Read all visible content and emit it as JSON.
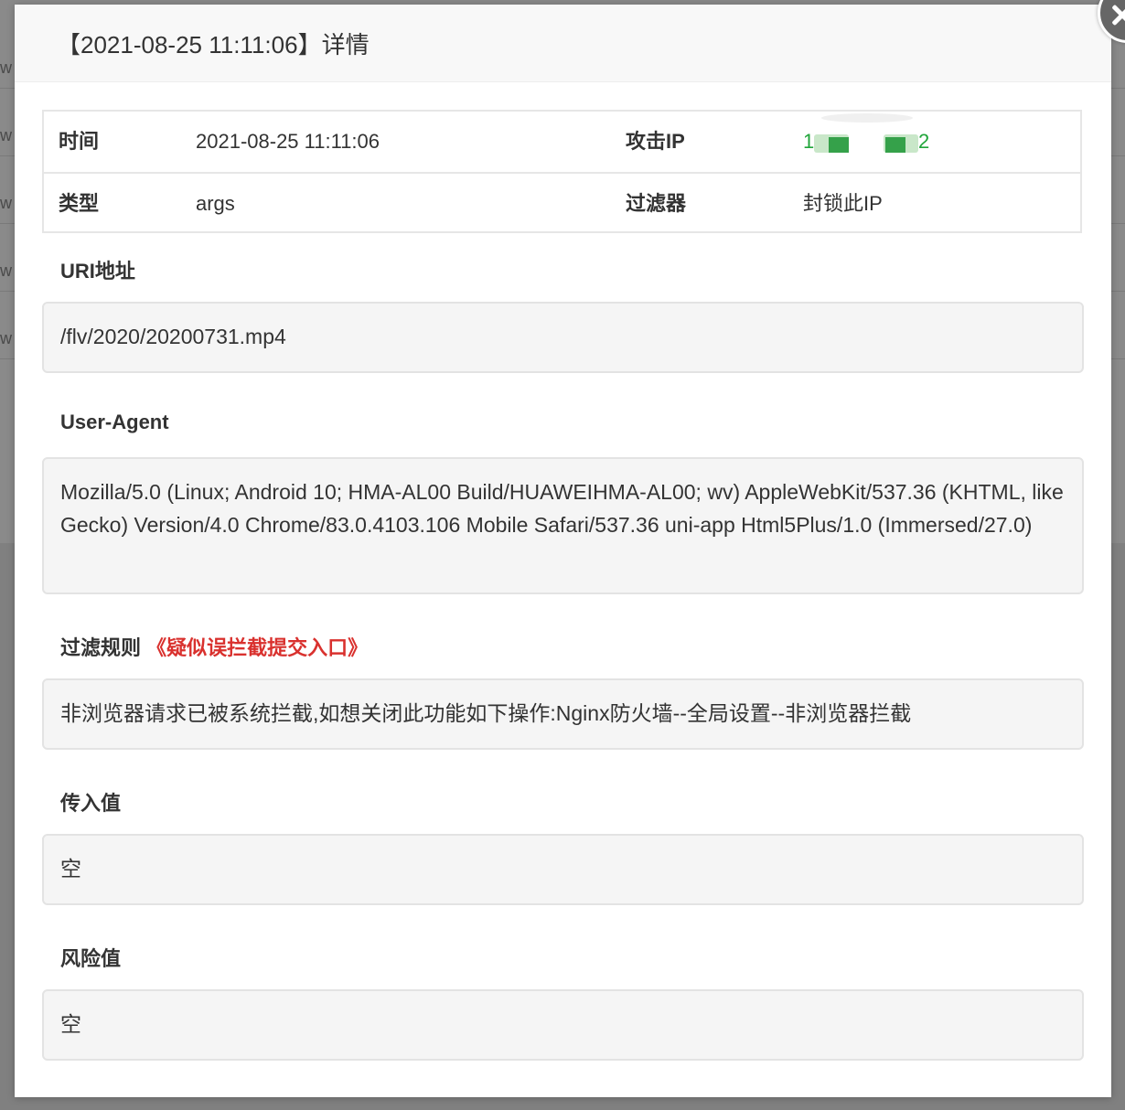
{
  "modal": {
    "title": "【2021-08-25 11:11:06】详情"
  },
  "info": {
    "time_label": "时间",
    "time_value": "2021-08-25 11:11:06",
    "attack_ip_label": "攻击IP",
    "attack_ip_start": "1",
    "attack_ip_end": "2",
    "type_label": "类型",
    "type_value": "args",
    "filter_label": "过滤器",
    "filter_value": "封锁此IP"
  },
  "sections": {
    "uri": {
      "label": "URI地址",
      "value": "/flv/2020/20200731.mp4"
    },
    "user_agent": {
      "label": "User-Agent",
      "value": "Mozilla/5.0 (Linux; Android 10; HMA-AL00 Build/HUAWEIHMA-AL00; wv) AppleWebKit/537.36 (KHTML, like Gecko) Version/4.0 Chrome/83.0.4103.106 Mobile Safari/537.36 uni-app Html5Plus/1.0 (Immersed/27.0)"
    },
    "filter_rule": {
      "label": "过滤规则",
      "link": "《疑似误拦截提交入口》",
      "value": "非浏览器请求已被系统拦截,如想关闭此功能如下操作:Nginx防火墙--全局设置--非浏览器拦截"
    },
    "input_value": {
      "label": "传入值",
      "value": "空"
    },
    "risk_value": {
      "label": "风险值",
      "value": "空"
    }
  },
  "colors": {
    "ip_green": "#20a53a",
    "link_red": "#d9312e"
  },
  "backdrop": {
    "row_glyph": "w"
  }
}
